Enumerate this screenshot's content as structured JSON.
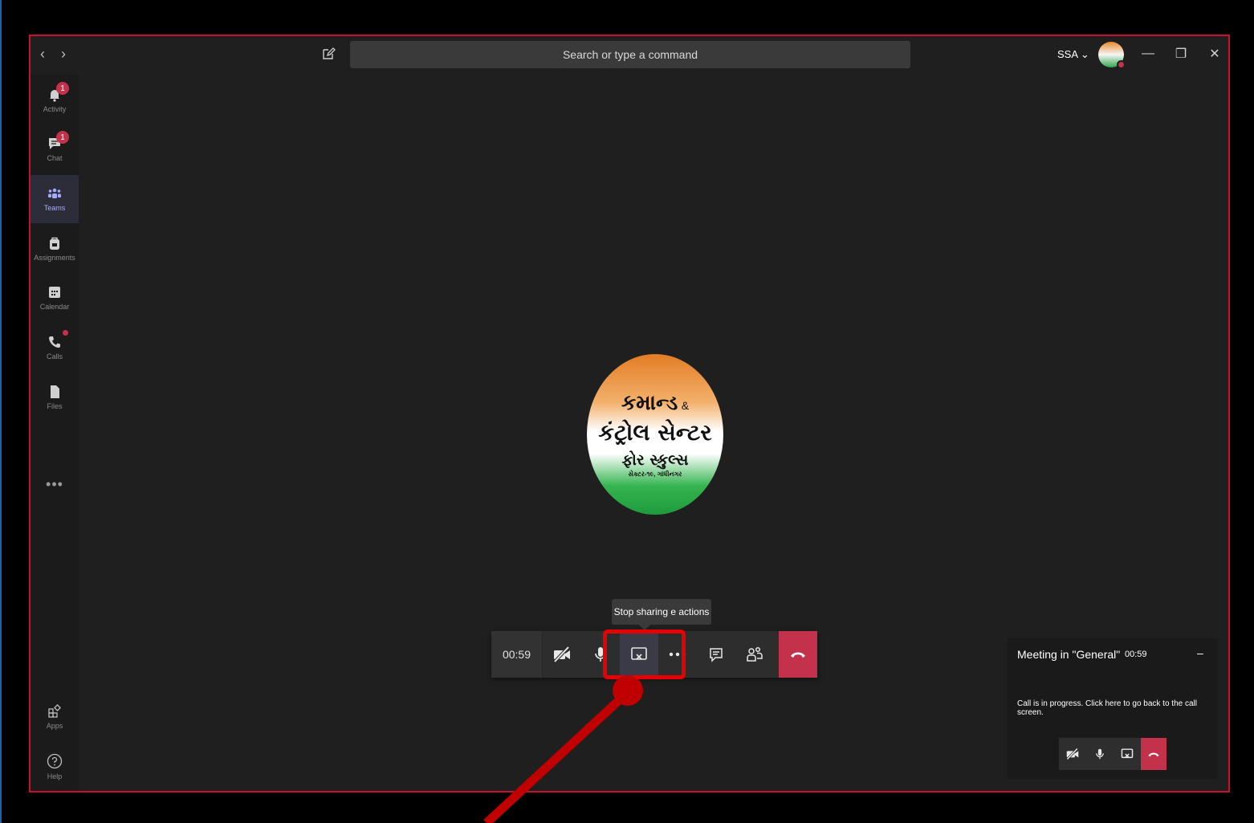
{
  "titlebar": {
    "search_placeholder": "Search or type a command",
    "user_label": "SSA ⌄",
    "back": "‹",
    "forward": "›",
    "minimize": "—",
    "restore": "❐",
    "close": "✕"
  },
  "rail": {
    "items": [
      {
        "label": "Activity",
        "badge": "1"
      },
      {
        "label": "Chat",
        "badge": "1"
      },
      {
        "label": "Teams"
      },
      {
        "label": "Assignments"
      },
      {
        "label": "Calendar"
      },
      {
        "label": "Calls"
      },
      {
        "label": "Files"
      }
    ],
    "more": "•••",
    "apps": "Apps",
    "help": "Help"
  },
  "logo": {
    "line1": "કમાન્ડ",
    "amp": "&",
    "line2": "કંટ્રોલ સેન્ટર",
    "line3": "ફોર સ્કુલ્સ",
    "line4": "સેક્ટર-૧૯, ગાંધીનગર"
  },
  "tooltip": {
    "text": "Stop sharing  e actions"
  },
  "callbar": {
    "time": "00:59"
  },
  "mini": {
    "title": "Meeting in \"General\"",
    "time": "00:59",
    "minimize": "–",
    "message": "Call is in progress. Click here to go back to the call screen."
  },
  "colors": {
    "window_border": "#c8102e",
    "end_call": "#c4314b",
    "annotation": "#e60000",
    "annotation_dark": "#c00000"
  }
}
